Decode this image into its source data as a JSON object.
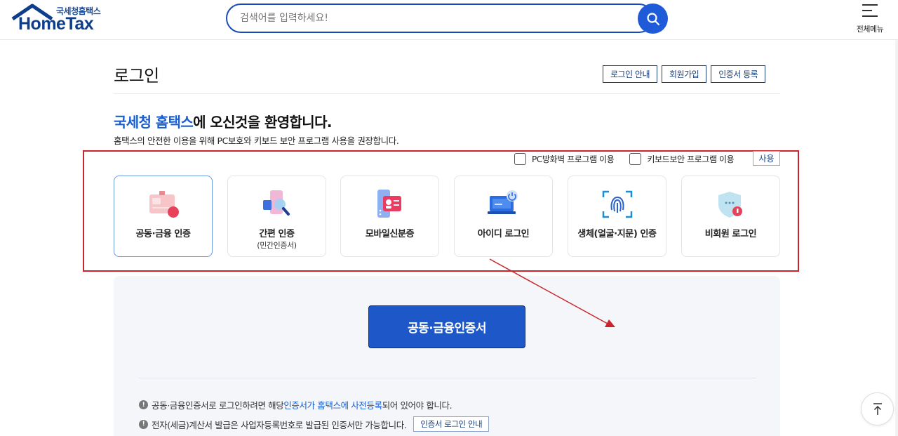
{
  "header": {
    "logo_sub": "국세청홈택스",
    "logo_main": "HomeTax",
    "search_placeholder": "검색어를 입력하세요!",
    "menu_label": "전체메뉴"
  },
  "page": {
    "title": "로그인",
    "buttons": [
      "로그인 안내",
      "회원가입",
      "인증서 등록"
    ],
    "welcome_accent": "국세청 홈택스",
    "welcome_rest": "에 오신것을 환영합니다.",
    "subtitle": "홈택스의 안전한 이용을 위해 PC보호와 키보드 보안 프로그램 사용을 권장합니다."
  },
  "security": {
    "options": [
      "PC방화벽 프로그램 이용",
      "키보드보안 프로그램 이용"
    ],
    "use_button": "사용"
  },
  "login_options": [
    {
      "label": "공동·금융 인증",
      "sublabel": "",
      "icon": "certificate-card-icon",
      "active": true
    },
    {
      "label": "간편 인증",
      "sublabel": "(민간인증서)",
      "icon": "simple-auth-icon",
      "active": false
    },
    {
      "label": "모바일신분증",
      "sublabel": "",
      "icon": "mobile-id-icon",
      "active": false
    },
    {
      "label": "아이디 로그인",
      "sublabel": "",
      "icon": "laptop-id-icon",
      "active": false
    },
    {
      "label": "생체(얼굴·지문) 인증",
      "sublabel": "",
      "icon": "fingerprint-icon",
      "active": false
    },
    {
      "label": "비회원 로그인",
      "sublabel": "",
      "icon": "guest-shield-icon",
      "active": false
    }
  ],
  "panel": {
    "primary_button": "공동·금융인증서",
    "note1_before": "공동·금융인증서로 로그인하려면 해당 ",
    "note1_link": "인증서가 홈택스에 사전등록",
    "note1_after": "되어 있어야 합니다.",
    "note2": "전자(세금)계산서 발급은 사업자등록번호로 발급된 인증서만 가능합니다.",
    "note2_button": "인증서 로그인 안내"
  },
  "colors": {
    "brand": "#0e3d8c",
    "accent": "#1a5fd0",
    "primary_button": "#1e57c8",
    "annotation_red": "#c9252c"
  }
}
